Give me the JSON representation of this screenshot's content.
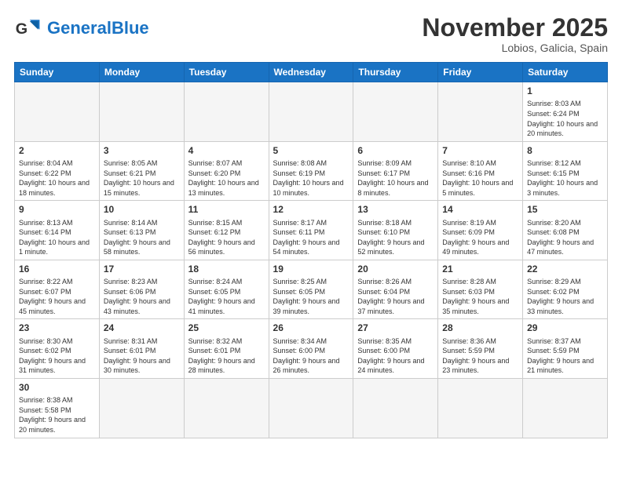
{
  "header": {
    "logo_general": "General",
    "logo_blue": "Blue",
    "month_title": "November 2025",
    "location": "Lobios, Galicia, Spain"
  },
  "days_of_week": [
    "Sunday",
    "Monday",
    "Tuesday",
    "Wednesday",
    "Thursday",
    "Friday",
    "Saturday"
  ],
  "weeks": [
    [
      {
        "day": "",
        "info": ""
      },
      {
        "day": "",
        "info": ""
      },
      {
        "day": "",
        "info": ""
      },
      {
        "day": "",
        "info": ""
      },
      {
        "day": "",
        "info": ""
      },
      {
        "day": "",
        "info": ""
      },
      {
        "day": "1",
        "info": "Sunrise: 8:03 AM\nSunset: 6:24 PM\nDaylight: 10 hours\nand 20 minutes."
      }
    ],
    [
      {
        "day": "2",
        "info": "Sunrise: 8:04 AM\nSunset: 6:22 PM\nDaylight: 10 hours\nand 18 minutes."
      },
      {
        "day": "3",
        "info": "Sunrise: 8:05 AM\nSunset: 6:21 PM\nDaylight: 10 hours\nand 15 minutes."
      },
      {
        "day": "4",
        "info": "Sunrise: 8:07 AM\nSunset: 6:20 PM\nDaylight: 10 hours\nand 13 minutes."
      },
      {
        "day": "5",
        "info": "Sunrise: 8:08 AM\nSunset: 6:19 PM\nDaylight: 10 hours\nand 10 minutes."
      },
      {
        "day": "6",
        "info": "Sunrise: 8:09 AM\nSunset: 6:17 PM\nDaylight: 10 hours\nand 8 minutes."
      },
      {
        "day": "7",
        "info": "Sunrise: 8:10 AM\nSunset: 6:16 PM\nDaylight: 10 hours\nand 5 minutes."
      },
      {
        "day": "8",
        "info": "Sunrise: 8:12 AM\nSunset: 6:15 PM\nDaylight: 10 hours\nand 3 minutes."
      }
    ],
    [
      {
        "day": "9",
        "info": "Sunrise: 8:13 AM\nSunset: 6:14 PM\nDaylight: 10 hours\nand 1 minute."
      },
      {
        "day": "10",
        "info": "Sunrise: 8:14 AM\nSunset: 6:13 PM\nDaylight: 9 hours\nand 58 minutes."
      },
      {
        "day": "11",
        "info": "Sunrise: 8:15 AM\nSunset: 6:12 PM\nDaylight: 9 hours\nand 56 minutes."
      },
      {
        "day": "12",
        "info": "Sunrise: 8:17 AM\nSunset: 6:11 PM\nDaylight: 9 hours\nand 54 minutes."
      },
      {
        "day": "13",
        "info": "Sunrise: 8:18 AM\nSunset: 6:10 PM\nDaylight: 9 hours\nand 52 minutes."
      },
      {
        "day": "14",
        "info": "Sunrise: 8:19 AM\nSunset: 6:09 PM\nDaylight: 9 hours\nand 49 minutes."
      },
      {
        "day": "15",
        "info": "Sunrise: 8:20 AM\nSunset: 6:08 PM\nDaylight: 9 hours\nand 47 minutes."
      }
    ],
    [
      {
        "day": "16",
        "info": "Sunrise: 8:22 AM\nSunset: 6:07 PM\nDaylight: 9 hours\nand 45 minutes."
      },
      {
        "day": "17",
        "info": "Sunrise: 8:23 AM\nSunset: 6:06 PM\nDaylight: 9 hours\nand 43 minutes."
      },
      {
        "day": "18",
        "info": "Sunrise: 8:24 AM\nSunset: 6:05 PM\nDaylight: 9 hours\nand 41 minutes."
      },
      {
        "day": "19",
        "info": "Sunrise: 8:25 AM\nSunset: 6:05 PM\nDaylight: 9 hours\nand 39 minutes."
      },
      {
        "day": "20",
        "info": "Sunrise: 8:26 AM\nSunset: 6:04 PM\nDaylight: 9 hours\nand 37 minutes."
      },
      {
        "day": "21",
        "info": "Sunrise: 8:28 AM\nSunset: 6:03 PM\nDaylight: 9 hours\nand 35 minutes."
      },
      {
        "day": "22",
        "info": "Sunrise: 8:29 AM\nSunset: 6:02 PM\nDaylight: 9 hours\nand 33 minutes."
      }
    ],
    [
      {
        "day": "23",
        "info": "Sunrise: 8:30 AM\nSunset: 6:02 PM\nDaylight: 9 hours\nand 31 minutes."
      },
      {
        "day": "24",
        "info": "Sunrise: 8:31 AM\nSunset: 6:01 PM\nDaylight: 9 hours\nand 30 minutes."
      },
      {
        "day": "25",
        "info": "Sunrise: 8:32 AM\nSunset: 6:01 PM\nDaylight: 9 hours\nand 28 minutes."
      },
      {
        "day": "26",
        "info": "Sunrise: 8:34 AM\nSunset: 6:00 PM\nDaylight: 9 hours\nand 26 minutes."
      },
      {
        "day": "27",
        "info": "Sunrise: 8:35 AM\nSunset: 6:00 PM\nDaylight: 9 hours\nand 24 minutes."
      },
      {
        "day": "28",
        "info": "Sunrise: 8:36 AM\nSunset: 5:59 PM\nDaylight: 9 hours\nand 23 minutes."
      },
      {
        "day": "29",
        "info": "Sunrise: 8:37 AM\nSunset: 5:59 PM\nDaylight: 9 hours\nand 21 minutes."
      }
    ],
    [
      {
        "day": "30",
        "info": "Sunrise: 8:38 AM\nSunset: 5:58 PM\nDaylight: 9 hours\nand 20 minutes."
      },
      {
        "day": "",
        "info": ""
      },
      {
        "day": "",
        "info": ""
      },
      {
        "day": "",
        "info": ""
      },
      {
        "day": "",
        "info": ""
      },
      {
        "day": "",
        "info": ""
      },
      {
        "day": "",
        "info": ""
      }
    ]
  ]
}
